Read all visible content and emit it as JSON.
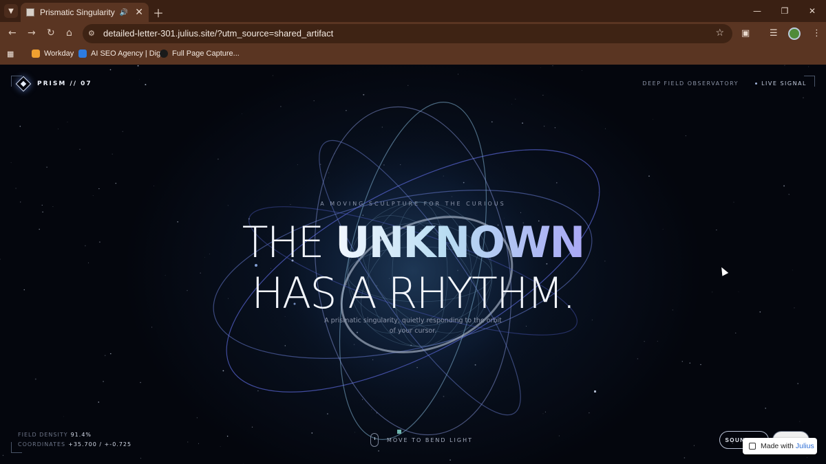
{
  "browser": {
    "tab_title": "Prismatic Singularity",
    "url": "detailed-letter-301.julius.site/?utm_source=shared_artifact",
    "bookmarks": [
      {
        "label": "Workday",
        "color": "#f0a030"
      },
      {
        "label": "AI SEO Agency | Dig...",
        "color": "#2d7be0"
      },
      {
        "label": "Full Page Capture...",
        "color": "#1a1a1a"
      }
    ],
    "icons": [
      "tab-menu-icon",
      "audio-icon",
      "close-icon",
      "plus-icon",
      "minimize-icon",
      "restore-icon",
      "back-icon",
      "forward-icon",
      "reload-icon",
      "home-icon",
      "site-settings-icon",
      "star-icon",
      "extensions-icon",
      "media-icon",
      "menu-icon",
      "apps-icon"
    ]
  },
  "page": {
    "brand": "PRISM // 07",
    "observatory": "DEEP FIELD OBSERVATORY",
    "live_signal": "LIVE SIGNAL",
    "eyebrow": "A MOVING SCULPTURE FOR THE CURIOUS",
    "headline_lead": "THE",
    "headline_accent": "UNKNOWN",
    "headline_line2": "HAS A RHYTHM.",
    "subtitle": "A prismatic singularity, quietly responding to the orbit of your cursor.",
    "stats": {
      "density_label": "FIELD DENSITY",
      "density_value": "91.4%",
      "coords_label": "COORDINATES",
      "coords_value": "+35.700 / +-0.725"
    },
    "hint": "MOVE TO BEND LIGHT",
    "sound_button": "SOUND ON",
    "pause_button": "PAUSE",
    "made_with_prefix": "Made with",
    "made_with_brand": "Julius"
  },
  "colors": {
    "chrome_dark": "#3a2013",
    "chrome": "#5a3522",
    "page_bg": "#05070f",
    "accent_cyan": "#b8dcf2",
    "accent_violet": "#a9a8f4"
  }
}
